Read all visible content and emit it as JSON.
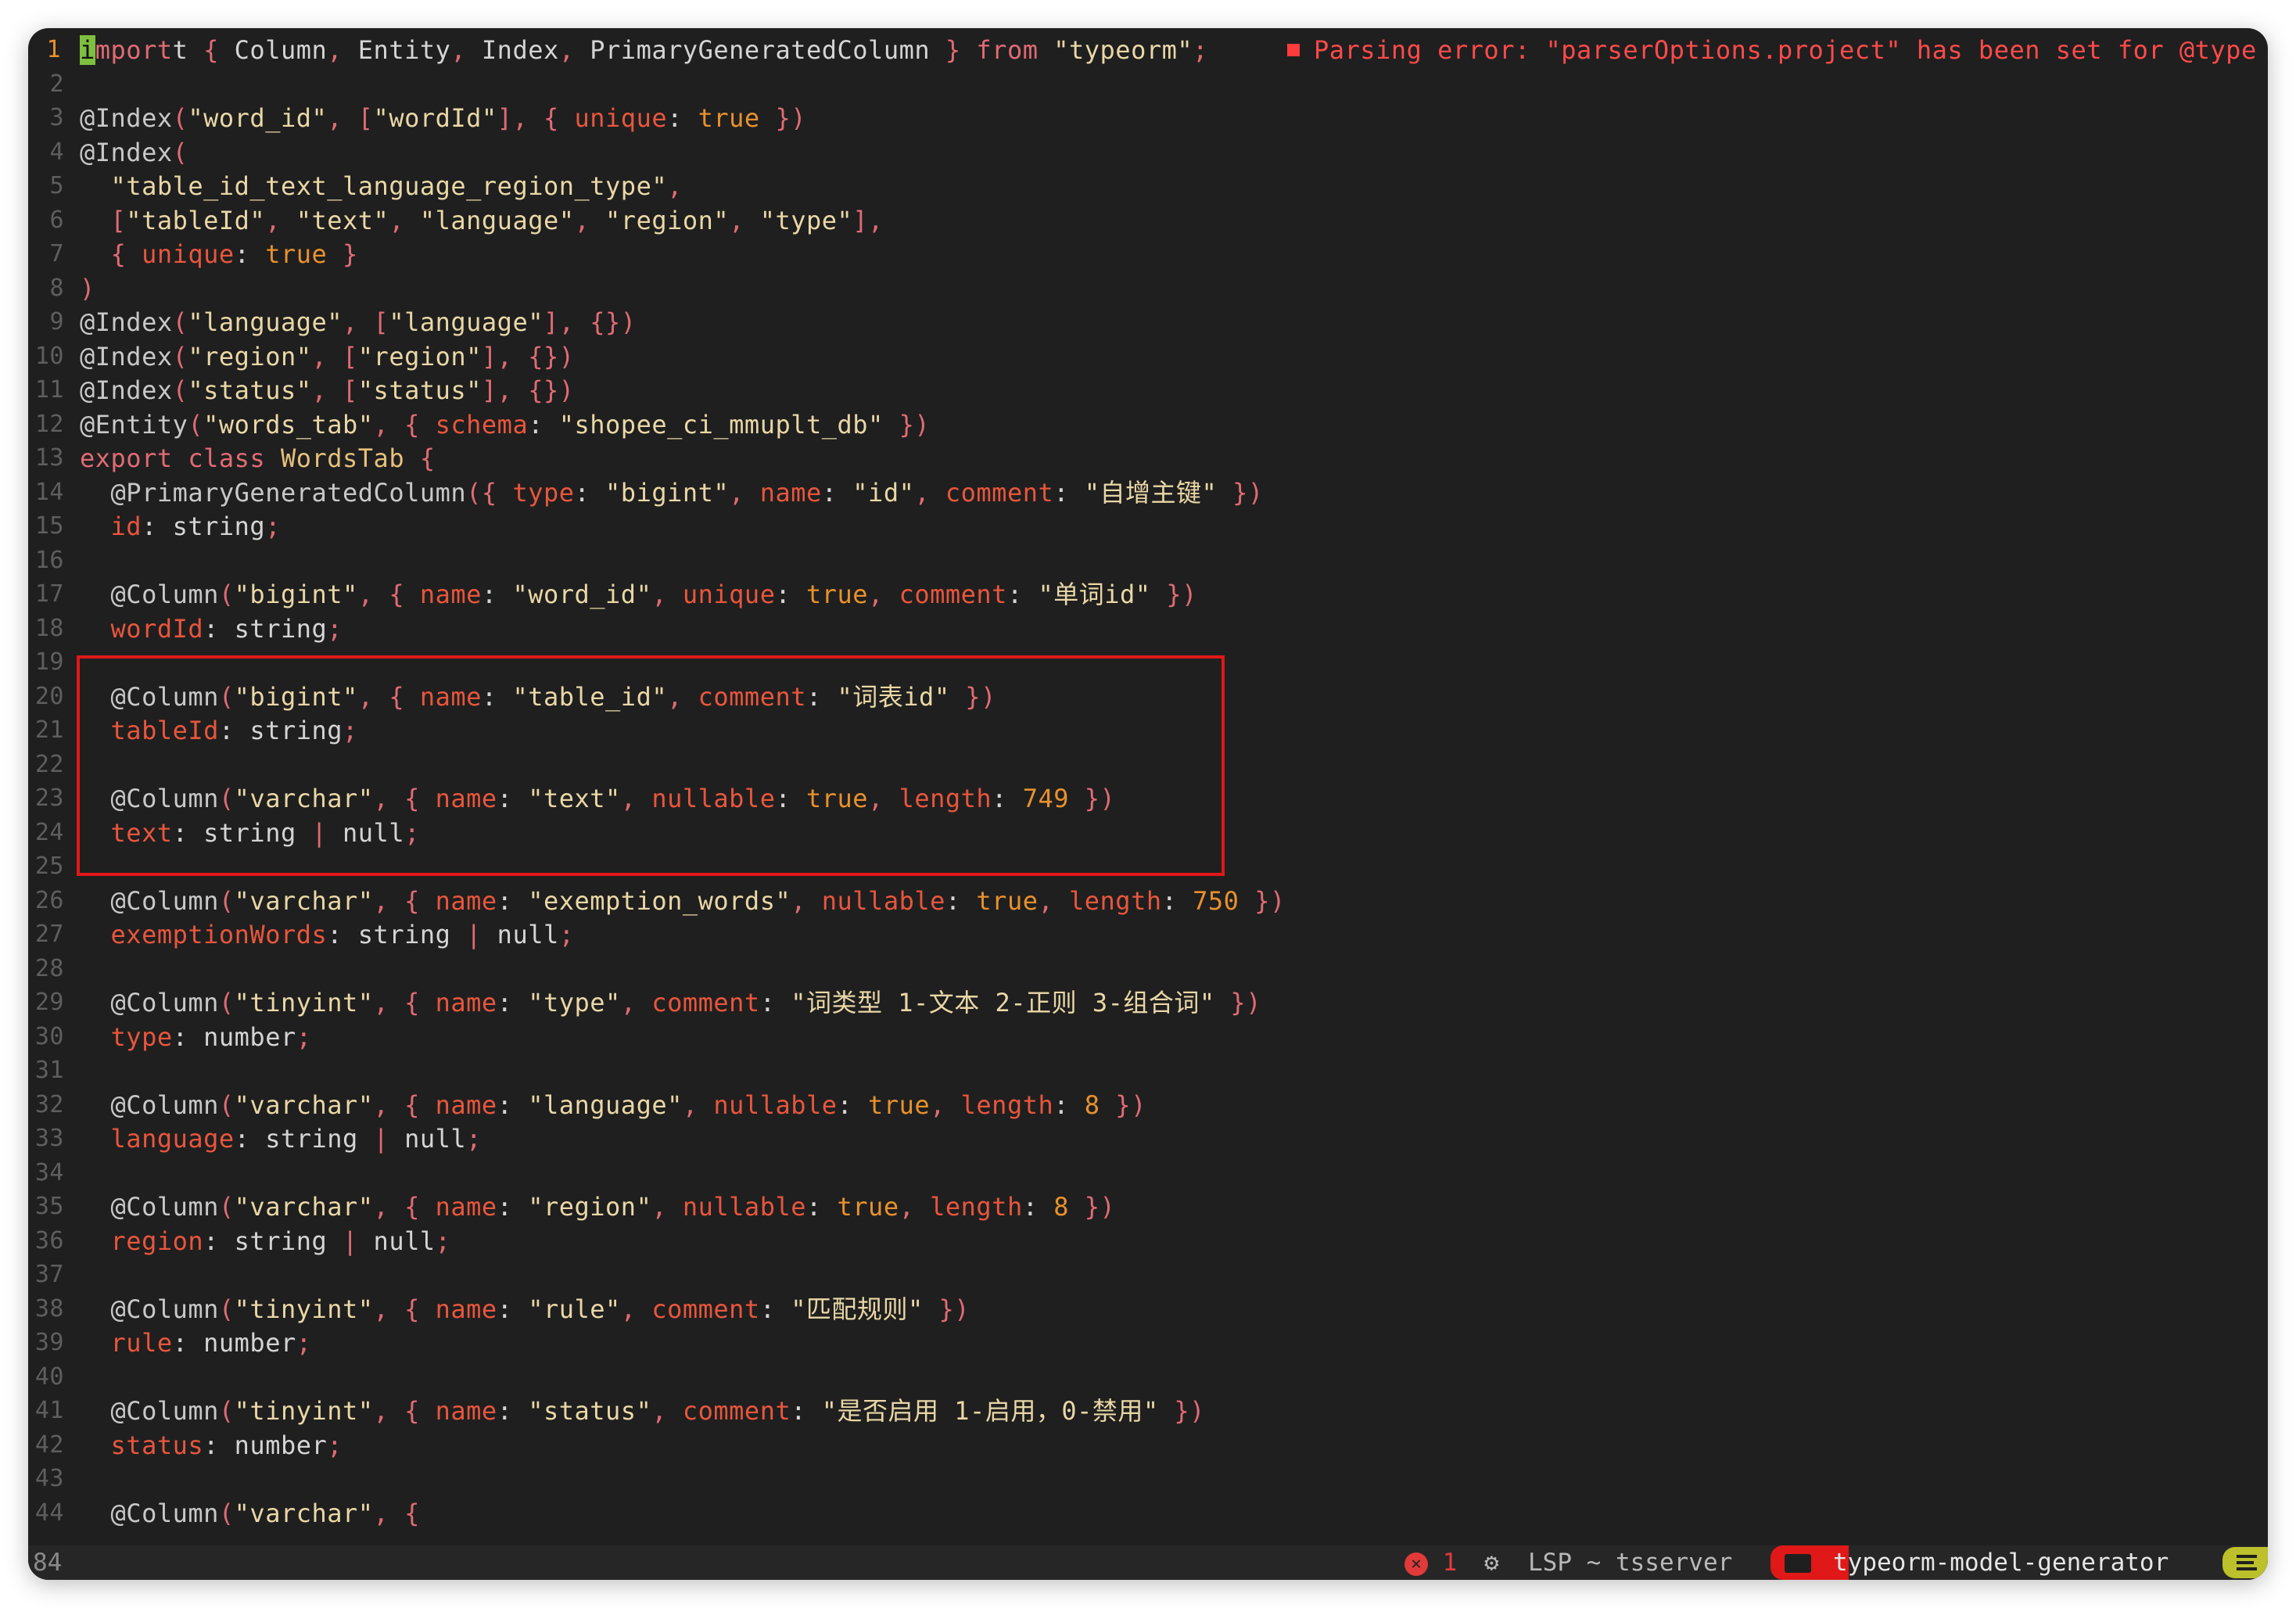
{
  "editor": {
    "cursor_char": "i",
    "diagnostic": "Parsing error: \"parserOptions.project\" has been set for @type",
    "lines": [
      {
        "n": "1",
        "t": "mport { Column, Entity, Index, PrimaryGeneratedColumn } from \"typeorm\";"
      },
      {
        "n": "2",
        "t": ""
      },
      {
        "n": "3",
        "t": "@Index(\"word_id\", [\"wordId\"], { unique: true })"
      },
      {
        "n": "4",
        "t": "@Index("
      },
      {
        "n": "5",
        "t": "  \"table_id_text_language_region_type\","
      },
      {
        "n": "6",
        "t": "  [\"tableId\", \"text\", \"language\", \"region\", \"type\"],"
      },
      {
        "n": "7",
        "t": "  { unique: true }"
      },
      {
        "n": "8",
        "t": ")"
      },
      {
        "n": "9",
        "t": "@Index(\"language\", [\"language\"], {})"
      },
      {
        "n": "10",
        "t": "@Index(\"region\", [\"region\"], {})"
      },
      {
        "n": "11",
        "t": "@Index(\"status\", [\"status\"], {})"
      },
      {
        "n": "12",
        "t": "@Entity(\"words_tab\", { schema: \"shopee_ci_mmuplt_db\" })"
      },
      {
        "n": "13",
        "t": "export class WordsTab {"
      },
      {
        "n": "14",
        "t": "  @PrimaryGeneratedColumn({ type: \"bigint\", name: \"id\", comment: \"自增主键\" })"
      },
      {
        "n": "15",
        "t": "  id: string;"
      },
      {
        "n": "16",
        "t": ""
      },
      {
        "n": "17",
        "t": "  @Column(\"bigint\", { name: \"word_id\", unique: true, comment: \"单词id\" })"
      },
      {
        "n": "18",
        "t": "  wordId: string;"
      },
      {
        "n": "19",
        "t": ""
      },
      {
        "n": "20",
        "t": "  @Column(\"bigint\", { name: \"table_id\", comment: \"词表id\" })"
      },
      {
        "n": "21",
        "t": "  tableId: string;"
      },
      {
        "n": "22",
        "t": ""
      },
      {
        "n": "23",
        "t": "  @Column(\"varchar\", { name: \"text\", nullable: true, length: 749 })"
      },
      {
        "n": "24",
        "t": "  text: string | null;"
      },
      {
        "n": "25",
        "t": ""
      },
      {
        "n": "26",
        "t": "  @Column(\"varchar\", { name: \"exemption_words\", nullable: true, length: 750 })"
      },
      {
        "n": "27",
        "t": "  exemptionWords: string | null;"
      },
      {
        "n": "28",
        "t": ""
      },
      {
        "n": "29",
        "t": "  @Column(\"tinyint\", { name: \"type\", comment: \"词类型 1-文本 2-正则 3-组合词\" })"
      },
      {
        "n": "30",
        "t": "  type: number;"
      },
      {
        "n": "31",
        "t": ""
      },
      {
        "n": "32",
        "t": "  @Column(\"varchar\", { name: \"language\", nullable: true, length: 8 })"
      },
      {
        "n": "33",
        "t": "  language: string | null;"
      },
      {
        "n": "34",
        "t": ""
      },
      {
        "n": "35",
        "t": "  @Column(\"varchar\", { name: \"region\", nullable: true, length: 8 })"
      },
      {
        "n": "36",
        "t": "  region: string | null;"
      },
      {
        "n": "37",
        "t": ""
      },
      {
        "n": "38",
        "t": "  @Column(\"tinyint\", { name: \"rule\", comment: \"匹配规则\" })"
      },
      {
        "n": "39",
        "t": "  rule: number;"
      },
      {
        "n": "40",
        "t": ""
      },
      {
        "n": "41",
        "t": "  @Column(\"tinyint\", { name: \"status\", comment: \"是否启用 1-启用，0-禁用\" })"
      },
      {
        "n": "42",
        "t": "  status: number;"
      },
      {
        "n": "43",
        "t": ""
      },
      {
        "n": "44",
        "t": "  @Column(\"varchar\", {"
      }
    ]
  },
  "statusbar": {
    "line_count": "84",
    "error_count": "1",
    "error_icon_glyph": "✕",
    "lsp_label": "LSP ~ tsserver",
    "project": "typeorm-model-generator"
  },
  "colors": {
    "background": "#1f1f1f",
    "highlight_box": "#e01818",
    "error": "#ff4a4a",
    "mode_badge": "#bcc02a"
  }
}
